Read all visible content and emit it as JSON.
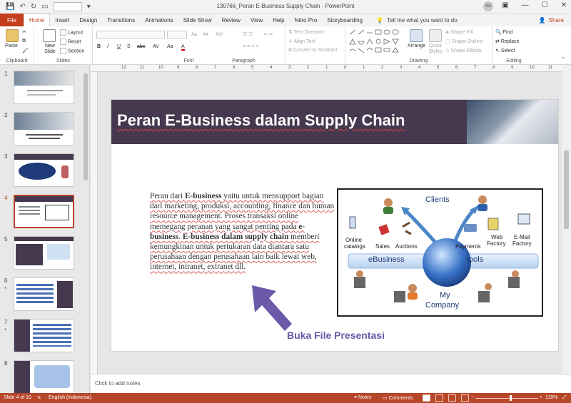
{
  "window": {
    "title": "130766_Peran E-Business Supply Chain  -  PowerPoint",
    "user_initials": "SA",
    "share_label": "Share",
    "tell_me": "Tell me what you want to do"
  },
  "tabs": [
    "File",
    "Home",
    "Insert",
    "Design",
    "Transitions",
    "Animations",
    "Slide Show",
    "Review",
    "View",
    "Help",
    "Nitro Pro",
    "Storyboarding"
  ],
  "active_tab": "Home",
  "ribbon": {
    "clipboard": {
      "label": "Clipboard",
      "paste": "Paste"
    },
    "slides": {
      "label": "Slides",
      "new_slide": "New Slide",
      "layout": "Layout",
      "reset": "Reset",
      "section": "Section"
    },
    "font": {
      "label": "Font",
      "buttons": [
        "B",
        "I",
        "U",
        "S",
        "abc",
        "AV",
        "Aa",
        "A"
      ]
    },
    "paragraph": {
      "label": "Paragraph",
      "text_direction": "Text Direction",
      "align_text": "Align Text",
      "smartart": "Convert to SmartArt"
    },
    "drawing": {
      "label": "Drawing",
      "arrange": "Arrange",
      "quick_styles": "Quick Styles",
      "shape_fill": "Shape Fill",
      "shape_outline": "Shape Outline",
      "shape_effects": "Shape Effects"
    },
    "editing": {
      "label": "Editing",
      "find": "Find",
      "replace": "Replace",
      "select": "Select"
    }
  },
  "thumbnails": [
    {
      "num": "1",
      "star": ""
    },
    {
      "num": "2",
      "star": ""
    },
    {
      "num": "3",
      "star": ""
    },
    {
      "num": "4",
      "star": ""
    },
    {
      "num": "5",
      "star": ""
    },
    {
      "num": "6",
      "star": "*"
    },
    {
      "num": "7",
      "star": "*"
    },
    {
      "num": "8",
      "star": ""
    }
  ],
  "active_slide": 4,
  "ruler_labels": [
    "12",
    "11",
    "10",
    "9",
    "8",
    "7",
    "6",
    "5",
    "4",
    "3",
    "2",
    "1",
    "0",
    "1",
    "2",
    "3",
    "4",
    "5",
    "6",
    "7",
    "8",
    "9",
    "10",
    "11",
    "12"
  ],
  "slide": {
    "title": "Peran E-Business dalam Supply Chain",
    "body": {
      "p1": "Peran dari ",
      "b1": "E-business",
      "p2": " yaitu untuk mensupport bagian dari marketing, produksi, accounting, finance dan human resource management. Proses transaksi online memegang peranan yang sangat penting pada ",
      "b2": "e-business",
      "p3": ". ",
      "b3": "E-business dalam supply chain",
      "p4": " memberi kemungkinan untuk pertukaran data diantara satu perusahaan dengan perusahaan lain baik lewat web, internet, intranet, extranet dll."
    },
    "diagram": {
      "clients": "Clients",
      "ebusiness": "eBusiness",
      "tools": "tools",
      "my": "My",
      "company": "Company",
      "online": "Online",
      "catalogs": "catalogs",
      "sales": "Sales",
      "auctions": "Auctions",
      "payments": "Payments",
      "web": "Web",
      "factory": "Factory",
      "email": "E-Mail",
      "factory2": "Factory"
    },
    "cta": "Buka File Presentasi"
  },
  "notes_placeholder": "Click to add notes",
  "status": {
    "slide_info": "Slide 4 of 10",
    "language": "English (Indonesia)",
    "notes": "Notes",
    "comments": "Comments",
    "zoom": "115%"
  },
  "colors": {
    "accent": "#b7472a",
    "file_tab": "#c43e1c",
    "banner": "#46394f",
    "cta": "#6a5aa8"
  }
}
